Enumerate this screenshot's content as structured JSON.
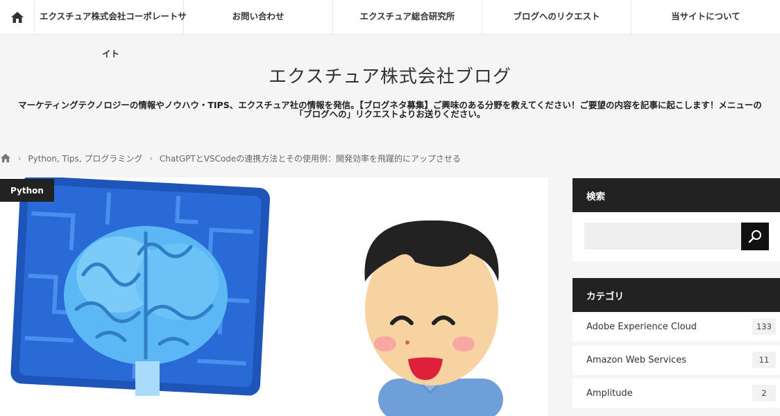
{
  "nav": {
    "items": [
      {
        "label": "エクスチュア株式会社コーポレートサ",
        "overflow": "イト"
      },
      {
        "label": "お問い合わせ"
      },
      {
        "label": "エクスチュア総合研究所"
      },
      {
        "label": "ブログへのリクエスト"
      },
      {
        "label": "当サイトについて"
      }
    ]
  },
  "header": {
    "title": "エクスチュア株式会社ブログ",
    "description_line1": "マーケティングテクノロジーの情報やノウハウ・TIPS、エクスチュア社の情報を発信。【ブログネタ募集】ご興味のある分野を教えてください！ご要望の内容を記事に起こします！メニューの",
    "description_line2": "「ブログへの」リクエストよりお送りください。"
  },
  "breadcrumb": {
    "categories": "Python, Tips, プログラミング",
    "current": "ChatGPTとVSCodeの連携方法とその使用例：開発効率を飛躍的にアップさせる"
  },
  "article": {
    "category_badge": "Python"
  },
  "sidebar": {
    "search_title": "検索",
    "search_placeholder": "",
    "category_title": "カテゴリ",
    "categories": [
      {
        "name": "Adobe Experience Cloud",
        "count": "133"
      },
      {
        "name": "Amazon Web Services",
        "count": "11"
      },
      {
        "name": "Amplitude",
        "count": "2"
      }
    ]
  },
  "icons": [
    "home-icon",
    "chevron-right-icon",
    "search-icon"
  ],
  "colors": {
    "accent": "#222222",
    "background": "#f5f5f5"
  }
}
